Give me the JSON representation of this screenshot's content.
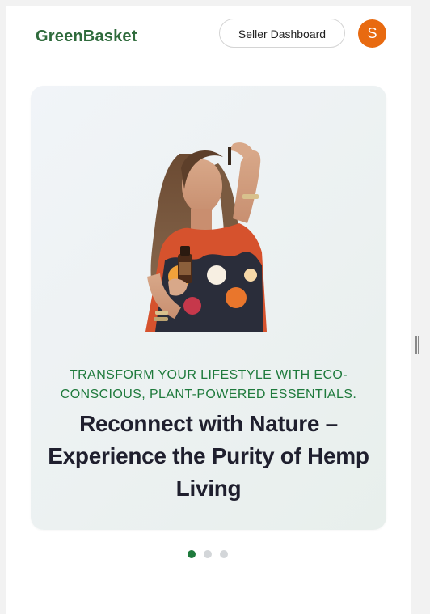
{
  "header": {
    "logo": "GreenBasket",
    "seller_dashboard_label": "Seller Dashboard",
    "avatar_initial": "S"
  },
  "hero": {
    "subtitle": "TRANSFORM YOUR LIFESTYLE WITH ECO-CONSCIOUS, PLANT-POWERED ESSENTIALS.",
    "headline": "Reconnect with Nature – Experience the Purity of Hemp Living",
    "image_icon": "woman-with-hemp-oil-bottle-image"
  },
  "carousel": {
    "slides": 3,
    "active_index": 0,
    "active_color": "#1e7a3c",
    "inactive_color": "#d3d6d9"
  },
  "colors": {
    "brand": "#2f6b3c",
    "accent": "#e86a10",
    "hero_text": "#1e7a3c"
  }
}
